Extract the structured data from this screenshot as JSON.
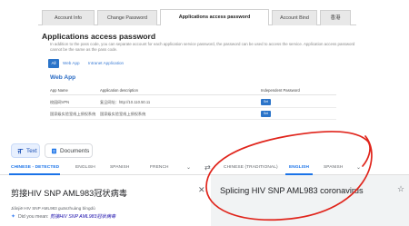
{
  "account_settings": {
    "tabs": [
      {
        "label": "Account Info",
        "active": false
      },
      {
        "label": "Change Password",
        "active": false
      },
      {
        "label": "Applications access password",
        "active": true
      },
      {
        "label": "Account Bind",
        "active": false
      },
      {
        "label": "香港",
        "active": false
      }
    ],
    "section_title": "Applications access password",
    "description": "In addition to the pass code, you can separate account for each application service password, the password can be used to access the service. Application access password cannot be the same as the pass code.",
    "filters": [
      "All",
      "Web App",
      "Intranet Application"
    ],
    "subsection_title": "Web App",
    "table": {
      "headers": [
        "App Name",
        "Application description",
        "Independent Password"
      ],
      "rows": [
        {
          "name": "校园网VPN",
          "description": "复旦网址：http://10.110.50.11",
          "button": "Set"
        },
        {
          "name": "国家级实验室线上授权系统",
          "description": "国家级实验室线上授权系统",
          "button": "Set"
        }
      ]
    }
  },
  "translator": {
    "mode_buttons": {
      "text": "Text",
      "documents": "Documents"
    },
    "source_langs": [
      "CHINESE - DETECTED",
      "ENGLISH",
      "SPANISH",
      "FRENCH"
    ],
    "target_langs": [
      "CHINESE (TRADITIONAL)",
      "ENGLISH",
      "SPANISH"
    ],
    "source_text": "剪接HIV SNP AML983冠状病毒",
    "transliteration": "Jiǎnjiē HIV SNP AML983 guānzhuàng bìngdú",
    "did_you_mean_label": "Did you mean:",
    "did_you_mean_value": "剪接HIV SNP AML983冠状病毒",
    "translated_text": "Splicing HIV SNP AML983 coronavirus"
  },
  "colors": {
    "accent_blue": "#1a73e8",
    "button_blue": "#2b74c9",
    "annotation_red": "#e0241b",
    "panel_gray": "#f1f3f4"
  },
  "icons": [
    "text-icon",
    "documents-icon",
    "chevron-down-icon",
    "swap-icon",
    "close-icon",
    "sparkle-icon",
    "star-icon"
  ]
}
